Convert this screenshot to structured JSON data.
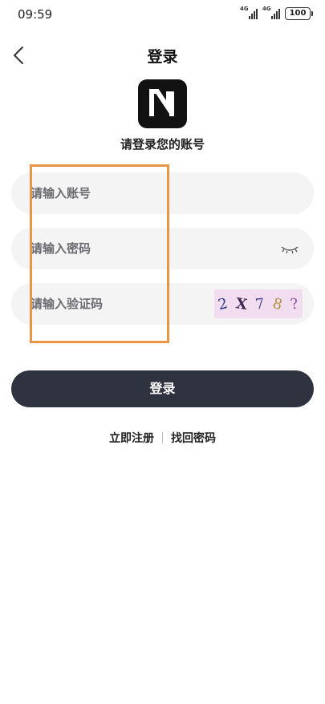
{
  "status_bar": {
    "time": "09:59",
    "signal1_label": "4G",
    "signal2_label": "4G",
    "battery": "100"
  },
  "header": {
    "back_icon": "chevron-left-icon",
    "title": "登录"
  },
  "logo": {
    "letter": "N",
    "background": "#121212"
  },
  "subtitle": "请登录您的账号",
  "form": {
    "account_placeholder": "请输入账号",
    "account_value": "",
    "password_placeholder": "请输入密码",
    "password_value": "",
    "password_toggle_icon": "eye-closed-icon",
    "captcha_placeholder": "请输入验证码",
    "captcha_value": "",
    "captcha_chars": [
      "2",
      "X",
      "7",
      "8",
      "?"
    ]
  },
  "login_button": "登录",
  "links": {
    "register": "立即注册",
    "forgot_password": "找回密码"
  },
  "colors": {
    "primary_button": "#2f3340",
    "field_background": "#f4f4f5",
    "annotation_border": "#e79646",
    "captcha_background": "#f1dcf0"
  }
}
